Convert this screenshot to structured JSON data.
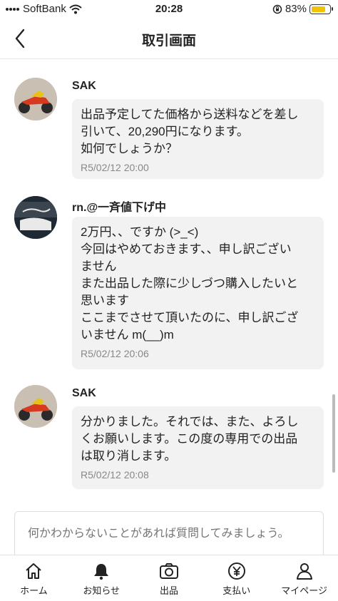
{
  "status_bar": {
    "carrier": "SoftBank",
    "time": "20:28",
    "battery": "83%",
    "battery_level": 0.83
  },
  "header": {
    "title": "取引画面"
  },
  "messages": [
    {
      "name": "SAK",
      "text": "出品予定してた価格から送料などを差し\n引いて、20,290円になります。\n如何でしょうか？",
      "time": "R5/02/12 20:00"
    },
    {
      "name": "rn.@一斉値下げ中",
      "text": "2万円、、ですか (>_<)\n今回はやめておきます、、申し訳ござい\nません\nまた出品した際に少しづつ購入したいと\n思います\nここまでさせて頂いたのに、申し訳ござ\nいません m(__)m",
      "time": "R5/02/12 20:06"
    },
    {
      "name": "SAK",
      "text": "分かりました。それでは、また、よろし\nくお願いします。この度の専用での出品\nは取り消します。",
      "time": "R5/02/12 20:08"
    }
  ],
  "input": {
    "placeholder": "何かわからないことがあれば質問してみましょう。"
  },
  "tabs": [
    {
      "label": "ホーム",
      "icon": "home-icon"
    },
    {
      "label": "お知らせ",
      "icon": "bell-icon"
    },
    {
      "label": "出品",
      "icon": "camera-icon"
    },
    {
      "label": "支払い",
      "icon": "yen-icon"
    },
    {
      "label": "マイページ",
      "icon": "person-icon"
    }
  ]
}
